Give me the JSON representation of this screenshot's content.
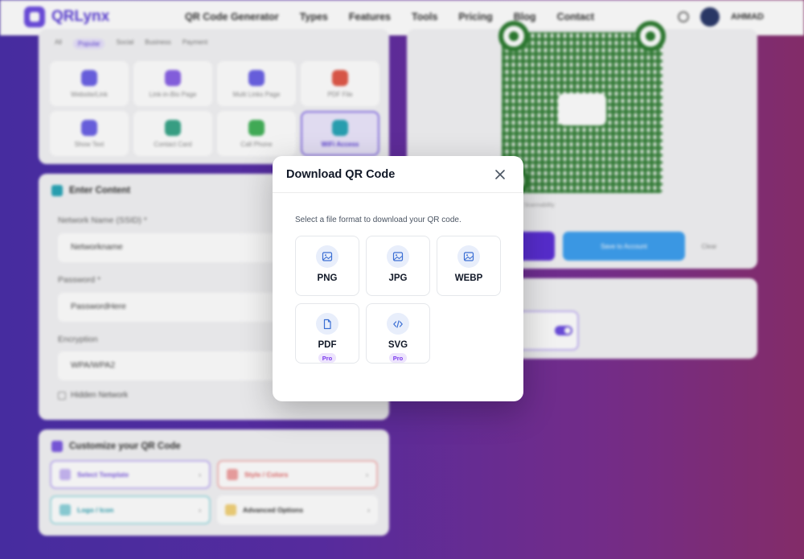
{
  "brand": {
    "name": "QRLynx"
  },
  "nav": {
    "items": [
      "QR Code Generator",
      "Types",
      "Features",
      "Tools",
      "Pricing",
      "Blog",
      "Contact"
    ],
    "user": "AHMAD"
  },
  "type_picker": {
    "tabs": [
      "All",
      "Popular",
      "Social",
      "Business",
      "Payment"
    ],
    "items": [
      "Website/Link",
      "Link-in-Bio Page",
      "Multi Links Page",
      "PDF File",
      "Show Text",
      "Contact Card",
      "Call Phone",
      "WiFi Access"
    ]
  },
  "content": {
    "title": "Enter Content",
    "ssid_label": "Network Name (SSID) *",
    "ssid_value": "Networkname",
    "password_label": "Password *",
    "password_value": "PasswordHere",
    "encryption_label": "Encryption",
    "encryption_value": "WPA/WPA2",
    "hidden_label": "Hidden Network"
  },
  "customize": {
    "title": "Customize your QR Code",
    "items": [
      "Select Template",
      "Style / Colors",
      "Logo / Icon",
      "Advanced Options"
    ]
  },
  "preview": {
    "scan_label": "Scannability",
    "save_label": "Save to Account",
    "clear_label": "Clear"
  },
  "modal": {
    "title": "Download QR Code",
    "description": "Select a file format to download your QR code.",
    "formats": [
      {
        "label": "PNG",
        "icon": "image-icon",
        "badge": ""
      },
      {
        "label": "JPG",
        "icon": "image-icon",
        "badge": ""
      },
      {
        "label": "WEBP",
        "icon": "image-icon",
        "badge": ""
      },
      {
        "label": "PDF",
        "icon": "file-icon",
        "badge": "Pro"
      },
      {
        "label": "SVG",
        "icon": "code-icon",
        "badge": "Pro"
      }
    ]
  },
  "colors": {
    "accent": "#5b3fd6",
    "icon_blue": "#3b6fd4",
    "pro_badge": "#7c3aed"
  }
}
